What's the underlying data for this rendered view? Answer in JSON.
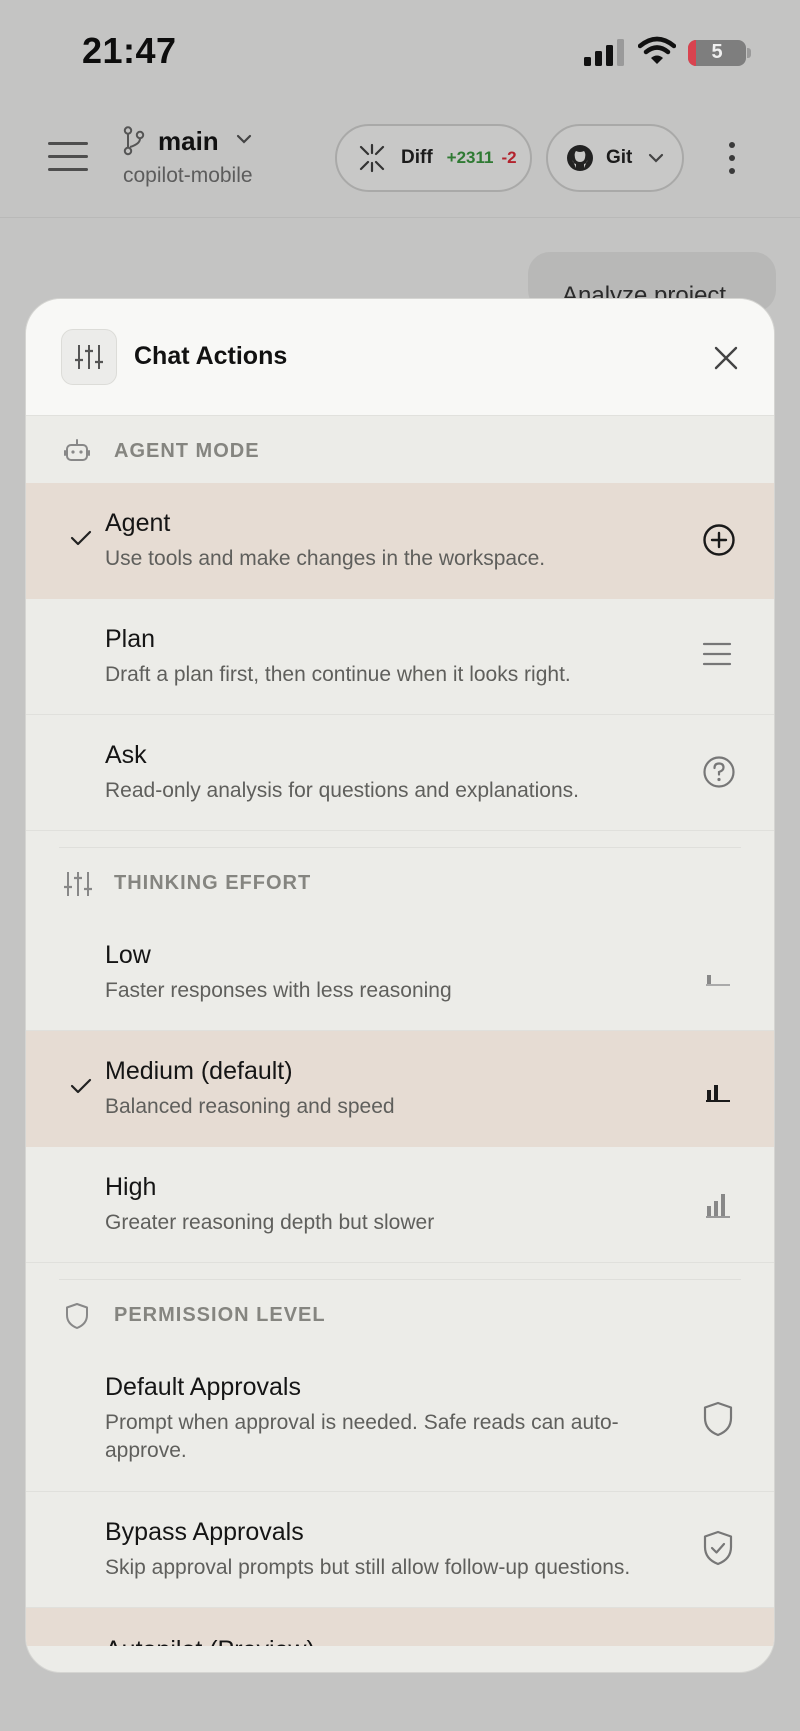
{
  "status_bar": {
    "time": "21:47",
    "battery_level": "5"
  },
  "app_bar": {
    "branch": "main",
    "repo": "copilot-mobile",
    "diff": {
      "label": "Diff",
      "added": "+2311",
      "removed": "-2"
    },
    "git": {
      "label": "Git"
    }
  },
  "background": {
    "message_preview": "Analyze project"
  },
  "sheet": {
    "title": "Chat Actions",
    "sections": {
      "agent_mode": {
        "title": "AGENT MODE",
        "options": [
          {
            "title": "Agent",
            "description": "Use tools and make changes in the workspace.",
            "selected": true,
            "icon": "plus-circle-icon"
          },
          {
            "title": "Plan",
            "description": "Draft a plan first, then continue when it looks right.",
            "selected": false,
            "icon": "lines-icon"
          },
          {
            "title": "Ask",
            "description": "Read-only analysis for questions and explanations.",
            "selected": false,
            "icon": "question-circle-icon"
          }
        ]
      },
      "thinking_effort": {
        "title": "THINKING EFFORT",
        "options": [
          {
            "title": "Low",
            "description": "Faster responses with less reasoning",
            "selected": false,
            "icon": "bars-low-icon"
          },
          {
            "title": "Medium (default)",
            "description": "Balanced reasoning and speed",
            "selected": true,
            "icon": "bars-medium-icon"
          },
          {
            "title": "High",
            "description": "Greater reasoning depth but slower",
            "selected": false,
            "icon": "bars-high-icon"
          }
        ]
      },
      "permission_level": {
        "title": "PERMISSION LEVEL",
        "options": [
          {
            "title": "Default Approvals",
            "description": "Prompt when approval is needed. Safe reads can auto-approve.",
            "selected": false,
            "icon": "shield-icon"
          },
          {
            "title": "Bypass Approvals",
            "description": "Skip approval prompts but still allow follow-up questions.",
            "selected": false,
            "icon": "shield-check-icon"
          },
          {
            "title": "Autopilot (Preview)",
            "description": "",
            "selected": true,
            "icon": ""
          }
        ]
      }
    }
  },
  "colors": {
    "selected_row": "#e6dcd3",
    "added": "#2f7a33",
    "removed": "#b3232d"
  }
}
